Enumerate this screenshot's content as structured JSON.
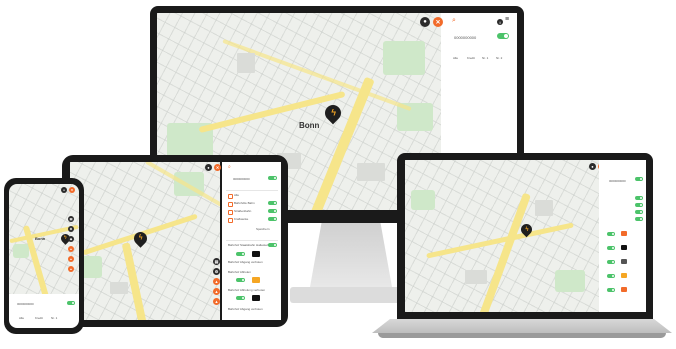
{
  "map": {
    "city_label": "Bonn"
  },
  "vehicle": {
    "id": "0000000000"
  },
  "status_row": {
    "labels": [
      "Alle",
      "Kredit",
      "Nr. 1",
      "Nr. 2"
    ]
  },
  "layers": [
    "Alle",
    "Bahnhöfe Bahn",
    "Straßenbahn",
    "Kraftwerke",
    "Tankstellen Sonstige"
  ],
  "layer_detail_label": "Speichern",
  "charge_rows": [
    "Bahnhof Staatsbahn Haltestelle Ver",
    "Bahnhof Abgang verboten",
    "Bahnhof Abholen",
    "Bahnhof Abholung verboten",
    "Bahnhof Abgang verboten"
  ],
  "colors": {
    "accent": "#f26b2a",
    "toggle": "#4cc36a",
    "pin": "#1f1f1f",
    "bolt": "#f5a623"
  },
  "icons": [
    "person-icon",
    "close-icon",
    "search-icon",
    "info-icon",
    "menu-icon",
    "map-pin-icon",
    "layers-icon",
    "settings-icon"
  ]
}
